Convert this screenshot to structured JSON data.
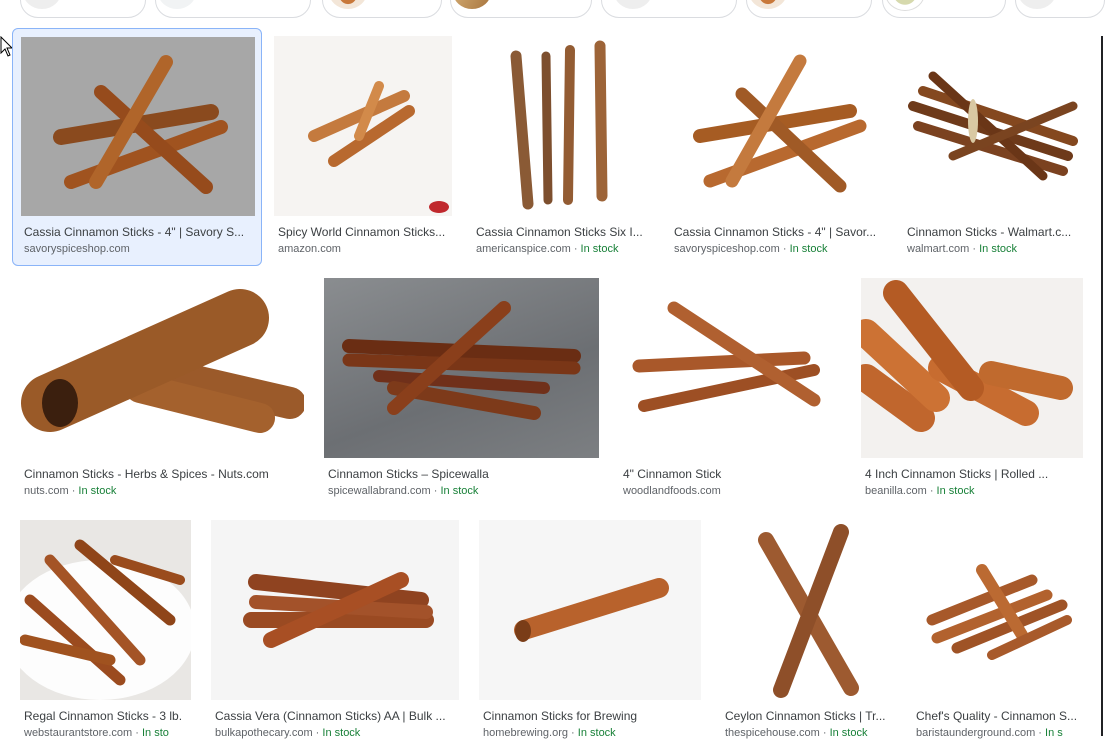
{
  "chips": [
    {
      "thumb": "cin2"
    },
    {
      "thumb": "plain"
    },
    {
      "thumb": "cin"
    },
    {
      "thumb": "wood"
    },
    {
      "thumb": "cin2"
    },
    {
      "thumb": "cin"
    },
    {
      "thumb": "cin"
    },
    {
      "thumb": "cin2"
    }
  ],
  "results": [
    {
      "title": "Cassia Cinnamon Sticks - 4\" | Savory S...",
      "source": "savoryspiceshop.com",
      "stock": ""
    },
    {
      "title": "Spicy World Cinnamon Sticks...",
      "source": "amazon.com",
      "stock": ""
    },
    {
      "title": "Cassia Cinnamon Sticks Six I...",
      "source": "americanspice.com",
      "stock": "In stock"
    },
    {
      "title": "Cassia Cinnamon Sticks - 4\" | Savor...",
      "source": "savoryspiceshop.com",
      "stock": "In stock"
    },
    {
      "title": "Cinnamon Sticks - Walmart.c...",
      "source": "walmart.com",
      "stock": "In stock"
    },
    {
      "title": "Cinnamon Sticks - Herbs & Spices - Nuts.com",
      "source": "nuts.com",
      "stock": "In stock"
    },
    {
      "title": "Cinnamon Sticks – Spicewalla",
      "source": "spicewallabrand.com",
      "stock": "In stock"
    },
    {
      "title": "4\" Cinnamon Stick",
      "source": "woodlandfoods.com",
      "stock": ""
    },
    {
      "title": "4 Inch Cinnamon Sticks | Rolled ...",
      "source": "beanilla.com",
      "stock": "In stock"
    },
    {
      "title": "Regal Cinnamon Sticks - 3 lb.",
      "source": "webstaurantstore.com",
      "stock": "In sto"
    },
    {
      "title": "Cassia Vera (Cinnamon Sticks) AA | Bulk ...",
      "source": "bulkapothecary.com",
      "stock": "In stock"
    },
    {
      "title": "Cinnamon Sticks for Brewing",
      "source": "homebrewing.org",
      "stock": "In stock"
    },
    {
      "title": "Ceylon Cinnamon Sticks | Tr...",
      "source": "thespicehouse.com",
      "stock": "In stock"
    },
    {
      "title": "Chef's Quality - Cinnamon S...",
      "source": "baristaunderground.com",
      "stock": "In s"
    }
  ],
  "separator": " · ",
  "colors": {
    "accent": "#8ab4f8",
    "stock_green": "#188038",
    "cinnamon": "#a0531f"
  },
  "icons": {
    "cursor": "mouse-pointer-icon"
  }
}
